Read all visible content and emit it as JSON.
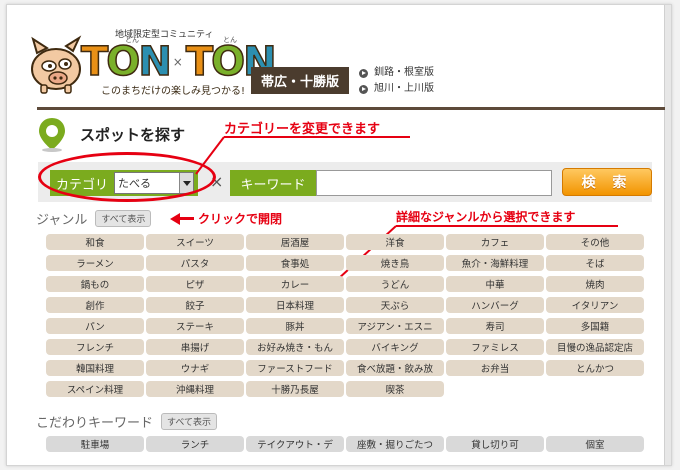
{
  "header": {
    "tagline_top": "地域限定型コミュニティ",
    "logo_left": "TON",
    "logo_times": "×",
    "logo_right": "TON",
    "ruby_left": "とん",
    "ruby_right": "とん",
    "tagline_bottom": "このまちだけの楽しみ見つかる!",
    "region_badge": "帯広・十勝版",
    "region_links": [
      "釧路・根室版",
      "旭川・上川版"
    ]
  },
  "spot": {
    "title": "スポットを探す"
  },
  "search": {
    "category_label": "カテゴリ",
    "category_value": "たべる",
    "clear_glyph": "×",
    "keyword_label": "キーワード",
    "keyword_value": "",
    "search_button": "検 索"
  },
  "annotations": {
    "change_category": "カテゴリーを変更できます",
    "click_to_open": "クリックで開閉",
    "select_genre": "詳細なジャンルから選択できます"
  },
  "genre": {
    "label": "ジャンル",
    "show_all": "すべて表示",
    "tags": [
      "和食",
      "スイーツ",
      "居酒屋",
      "洋食",
      "カフェ",
      "その他",
      "ラーメン",
      "パスタ",
      "食事処",
      "焼き鳥",
      "魚介・海鮮料理",
      "そば",
      "鍋もの",
      "ピザ",
      "カレー",
      "うどん",
      "中華",
      "焼肉",
      "創作",
      "餃子",
      "日本料理",
      "天ぷら",
      "ハンバーグ",
      "イタリアン",
      "パン",
      "ステーキ",
      "豚丼",
      "アジアン・エスニ",
      "寿司",
      "多国籍",
      "フレンチ",
      "串揚げ",
      "お好み焼き・もん",
      "バイキング",
      "ファミレス",
      "目慢の逸品認定店",
      "韓国料理",
      "ウナギ",
      "ファーストフード",
      "食べ放題・飲み放",
      "お弁当",
      "とんかつ",
      "スペイン料理",
      "沖縄料理",
      "十勝乃長屋",
      "喫茶"
    ]
  },
  "keywords": {
    "label": "こだわりキーワード",
    "show_all": "すべて表示",
    "tags": [
      "駐車場",
      "ランチ",
      "テイクアウト・デ",
      "座敷・掘りごたつ",
      "貸し切り可",
      "個室"
    ]
  },
  "colors": {
    "accent_green": "#7bab1e",
    "search_orange": "#f29400",
    "annotation_red": "#e60012",
    "genre_tag_bg": "#e3d8c9",
    "keyword_tag_bg": "#d9d9d9",
    "brand_dark": "#4b3c2e"
  }
}
